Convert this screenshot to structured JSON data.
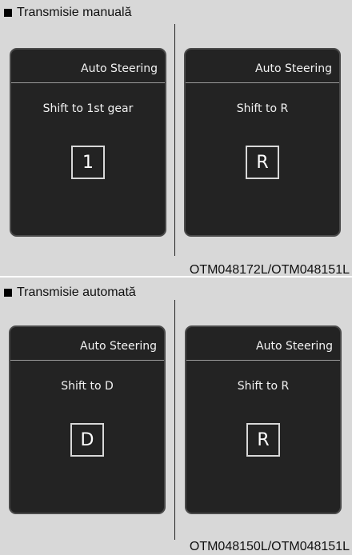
{
  "sections": [
    {
      "heading": "Transmisie manuală",
      "caption": "OTM048172L/OTM048151L",
      "screens": [
        {
          "title": "Auto Steering",
          "message": "Shift to 1st gear",
          "gear": "1"
        },
        {
          "title": "Auto Steering",
          "message": "Shift to R",
          "gear": "R"
        }
      ]
    },
    {
      "heading": "Transmisie automată",
      "caption": "OTM048150L/OTM048151L",
      "screens": [
        {
          "title": "Auto Steering",
          "message": "Shift to D",
          "gear": "D"
        },
        {
          "title": "Auto Steering",
          "message": "Shift to R",
          "gear": "R"
        }
      ]
    }
  ],
  "icons": {
    "bullet": "black-square-bullet-icon"
  },
  "colors": {
    "panel_bg": "#d8d8d8",
    "screen_bg": "#232323",
    "screen_text": "#f2f2f2"
  }
}
